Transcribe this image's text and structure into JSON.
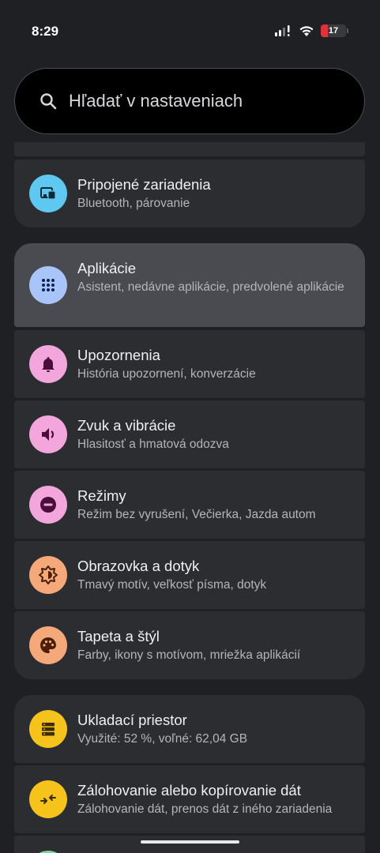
{
  "status_bar": {
    "time": "8:29",
    "battery": "17"
  },
  "search": {
    "placeholder": "Hľadať v nastaveniach"
  },
  "items": [
    {
      "title": "Pripojené zariadenia",
      "subtitle": "Bluetooth, párovanie",
      "icon": "connected-devices-icon",
      "color": "#5ec8f0"
    },
    {
      "title": "Aplikácie",
      "subtitle": "Asistent, nedávne aplikácie, predvolené aplikácie",
      "icon": "apps-grid-icon",
      "color": "#a8c4f8"
    },
    {
      "title": "Upozornenia",
      "subtitle": "História upozornení, konverzácie",
      "icon": "bell-icon",
      "color": "#f3a6dc"
    },
    {
      "title": "Zvuk a vibrácie",
      "subtitle": "Hlasitosť a hmatová odozva",
      "icon": "speaker-icon",
      "color": "#f3a6dc"
    },
    {
      "title": "Režimy",
      "subtitle": "Režim bez vyrušení, Večierka, Jazda autom",
      "icon": "do-not-disturb-icon",
      "color": "#f3a6dc"
    },
    {
      "title": "Obrazovka a dotyk",
      "subtitle": "Tmavý motív, veľkosť písma, dotyk",
      "icon": "brightness-icon",
      "color": "#f5a97a"
    },
    {
      "title": "Tapeta a štýl",
      "subtitle": "Farby, ikony s motívom, mriežka aplikácií",
      "icon": "palette-icon",
      "color": "#f5a97a"
    },
    {
      "title": "Ukladací priestor",
      "subtitle": "Využité: 52 %, voľné: 62,04 GB",
      "icon": "storage-icon",
      "color": "#f6c21c"
    },
    {
      "title": "Zálohovanie alebo kopírovanie dát",
      "subtitle": "Zálohovanie dát, prenos dát z iného zariadenia",
      "icon": "backup-transfer-icon",
      "color": "#f6c21c"
    }
  ]
}
